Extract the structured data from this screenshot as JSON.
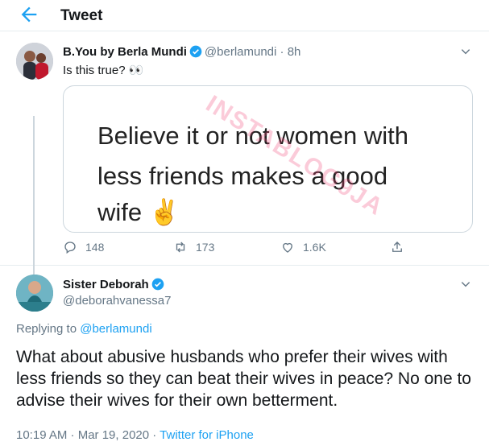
{
  "header": {
    "title": "Tweet",
    "back_icon": "arrow-left-icon"
  },
  "tweet1": {
    "name": "B.You by Berla Mundi",
    "handle": "@berlamundi",
    "time": "8h",
    "text": "Is this true? 👀",
    "image": {
      "lines": [
        "Believe it or not women with",
        "less friends makes a good",
        "wife ✌️"
      ],
      "watermark": "INSTABLOG9JA"
    },
    "actions": {
      "replies": "148",
      "retweets": "173",
      "likes": "1.6K"
    }
  },
  "tweet2": {
    "name": "Sister Deborah",
    "handle": "@deborahvanessa7",
    "replying_prefix": "Replying to",
    "replying_handle": "@berlamundi",
    "body": "What about abusive husbands who prefer their wives with less friends so they can beat their wives in peace? No one to advise their wives for their own betterment.",
    "meta_time": "10:19 AM · Mar 19, 2020 · ",
    "meta_source": "Twitter for iPhone"
  },
  "colors": {
    "accent": "#1da1f2",
    "muted": "#657786",
    "border": "#e6ecf0"
  }
}
